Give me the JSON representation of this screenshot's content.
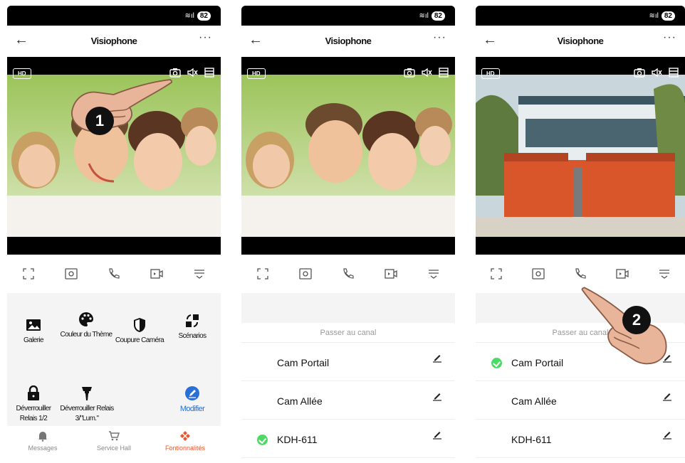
{
  "status": {
    "battery": "82"
  },
  "screens": [
    {
      "title": "Visiophone",
      "hd": "HD",
      "grid": [
        {
          "label": "Galerie"
        },
        {
          "label": "Couleur du Thème"
        },
        {
          "label": "Coupure Caméra"
        },
        {
          "label": "Scénarios"
        },
        {
          "label": "Déverrouiller Relais 1/2"
        },
        {
          "label": "Déverrouiller Relais 3/\"Lum.\""
        },
        {
          "label": "Modifier"
        }
      ],
      "tabs": [
        {
          "label": "Messages"
        },
        {
          "label": "Service Hall"
        },
        {
          "label": "Fontionnalités"
        }
      ],
      "step": "1"
    },
    {
      "title": "Visiophone",
      "hd": "HD",
      "sheet_title": "Passer au canal",
      "channels": [
        {
          "label": "Cam Portail",
          "selected": false
        },
        {
          "label": "Cam Allée",
          "selected": false
        },
        {
          "label": "KDH-611",
          "selected": true
        }
      ]
    },
    {
      "title": "Visiophone",
      "hd": "HD",
      "sheet_title": "Passer au canal",
      "channels": [
        {
          "label": "Cam Portail",
          "selected": true
        },
        {
          "label": "Cam Allée",
          "selected": false
        },
        {
          "label": "KDH-611",
          "selected": false
        }
      ],
      "step": "2"
    }
  ],
  "colors": {
    "accent": "#e8572d",
    "check": "#4cd964",
    "modify": "#2a6fd6"
  }
}
